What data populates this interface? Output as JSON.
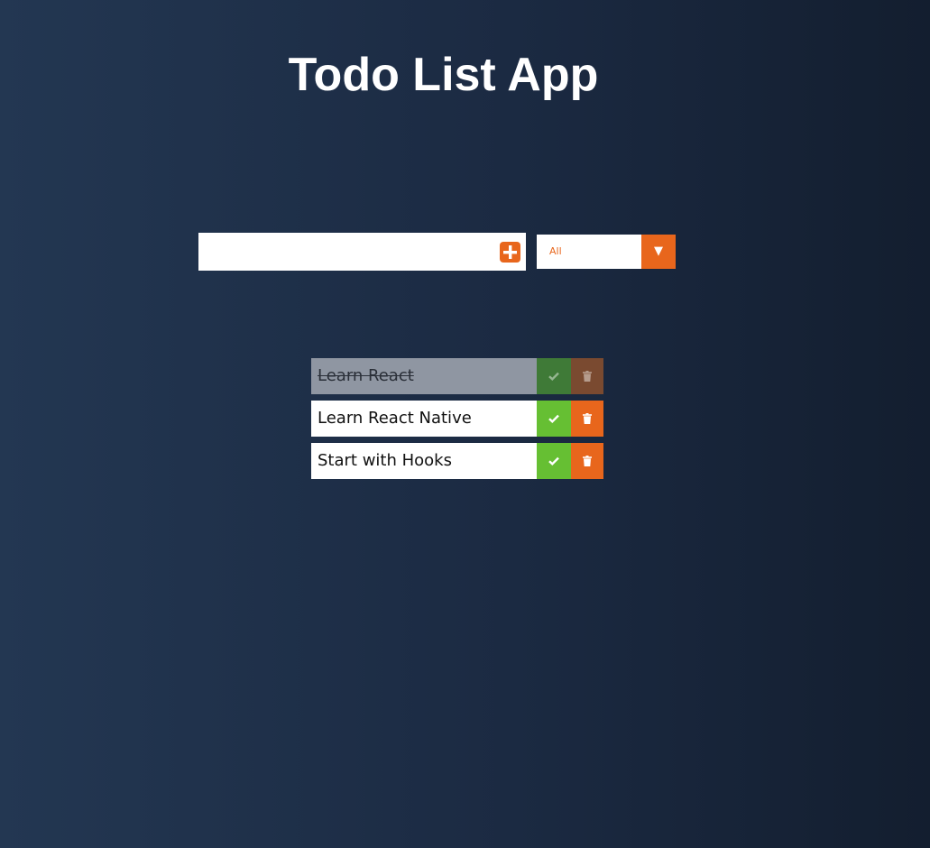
{
  "app": {
    "title": "Todo List App"
  },
  "form": {
    "input_value": "",
    "input_placeholder": "",
    "add_icon": "plus-square-icon",
    "filter_selected": "All",
    "filter_arrow": "▼"
  },
  "todos": [
    {
      "text": "Learn React",
      "completed": true
    },
    {
      "text": "Learn React Native",
      "completed": false
    },
    {
      "text": "Start with Hooks",
      "completed": false
    }
  ],
  "icons": {
    "complete": "check-icon",
    "delete": "trash-icon"
  },
  "colors": {
    "accent": "#e8661c",
    "complete": "#66bf33",
    "background_left": "#233752",
    "background_right": "#131e2f"
  }
}
